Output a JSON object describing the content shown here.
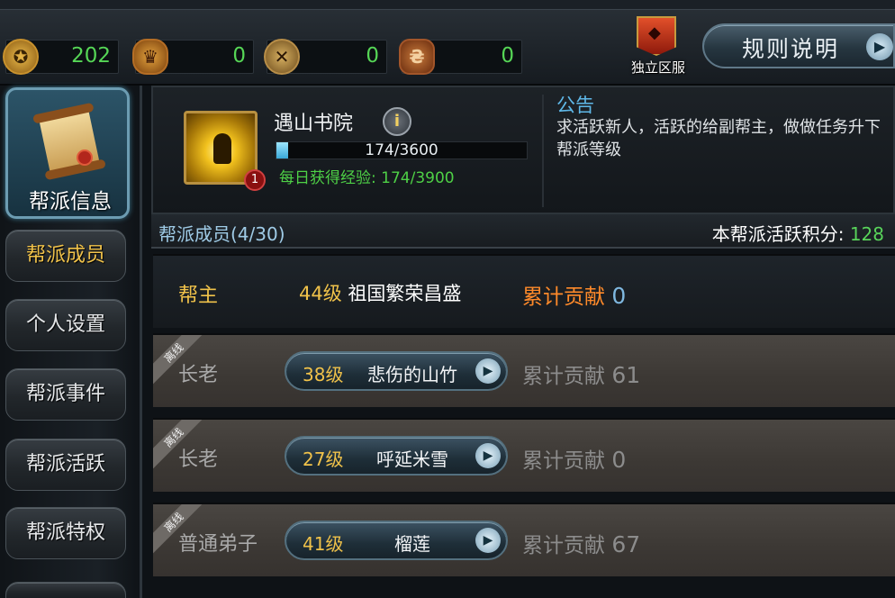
{
  "resources": [
    {
      "icon": "coin-icon",
      "value": "202"
    },
    {
      "icon": "helmet-icon",
      "value": "0"
    },
    {
      "icon": "crossed-swords-icon",
      "value": "0"
    },
    {
      "icon": "badge-icon",
      "value": "0"
    }
  ],
  "region": {
    "label": "独立区服"
  },
  "rules_button": {
    "label": "规则说明"
  },
  "nav": {
    "main": "帮派信息",
    "items": [
      "帮派成员",
      "个人设置",
      "帮派事件",
      "帮派活跃",
      "帮派特权"
    ]
  },
  "guild": {
    "name": "遇山书院",
    "level_badge": "1",
    "exp_text": "174/3600",
    "exp_progress": 0.048,
    "daily_label": "每日获得经验:",
    "daily_value": "174/3900",
    "notice_title": "公告",
    "notice_text": "求活跃新人，活跃的给副帮主，做做任务升下帮派等级"
  },
  "members_header": {
    "count_label": "帮派成员(4/30)",
    "activity_label": "本帮派活跃积分:",
    "activity_value": "128"
  },
  "leader": {
    "role": "帮主",
    "level": "44级",
    "name": "祖国繁荣昌盛",
    "contrib_label": "累计贡献",
    "contrib": "0"
  },
  "members": [
    {
      "status": "离线",
      "role": "长老",
      "level": "38级",
      "name": "悲伤的山竹",
      "contrib_label": "累计贡献",
      "contrib": "61"
    },
    {
      "status": "离线",
      "role": "长老",
      "level": "27级",
      "name": "呼延米雪",
      "contrib_label": "累计贡献",
      "contrib": "0"
    },
    {
      "status": "离线",
      "role": "普通弟子",
      "level": "41级",
      "name": "榴莲",
      "contrib_label": "累计贡献",
      "contrib": "67"
    }
  ],
  "colors": {
    "accent_gold": "#f0c24a",
    "online_green": "#56d656",
    "notice_blue": "#5fb8e8"
  }
}
